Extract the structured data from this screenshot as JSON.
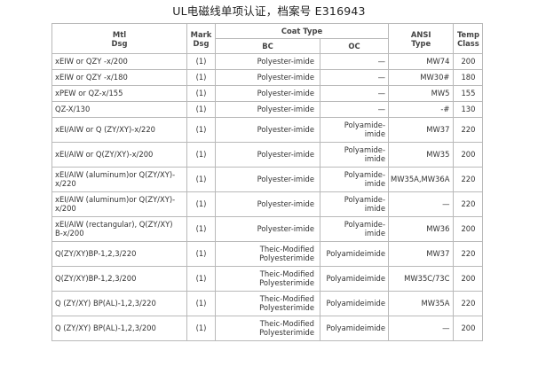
{
  "title": "UL电磁线单项认证，档案号 E316943",
  "table": {
    "headers": {
      "mtl": [
        "Mtl",
        "Dsg"
      ],
      "mark": [
        "Mark",
        "Dsg"
      ],
      "coat_type": "Coat Type",
      "bc": "BC",
      "oc": "OC",
      "ansi": [
        "ANSI",
        "Type"
      ],
      "temp": [
        "Temp",
        "Class"
      ]
    },
    "rows": [
      {
        "mtl": [
          "xEIW or QZY -x/200"
        ],
        "mark": "(1)",
        "bc": [
          "Polyester-imide"
        ],
        "oc": [
          "—"
        ],
        "ansi": "MW74",
        "temp": "200"
      },
      {
        "mtl": [
          "xEIW or QZY -x/180"
        ],
        "mark": "(1)",
        "bc": [
          "Polyester-imide"
        ],
        "oc": [
          "—"
        ],
        "ansi": "MW30#",
        "temp": "180"
      },
      {
        "mtl": [
          "xPEW or QZ-x/155"
        ],
        "mark": "(1)",
        "bc": [
          "Polyester-imide"
        ],
        "oc": [
          "—"
        ],
        "ansi": "MW5",
        "temp": "155"
      },
      {
        "mtl": [
          "QZ-X/130"
        ],
        "mark": "(1)",
        "bc": [
          "Polyester-imide"
        ],
        "oc": [
          "—"
        ],
        "ansi": "-#",
        "temp": "130"
      },
      {
        "mtl": [
          "xEI/AIW or Q (ZY/XY)-x/220"
        ],
        "mark": "(1)",
        "bc": [
          "Polyester-imide"
        ],
        "oc": [
          "Polyamide-",
          "imide"
        ],
        "ansi": "MW37",
        "temp": "220"
      },
      {
        "mtl": [
          "xEI/AIW or Q(ZY/XY)-x/200"
        ],
        "mark": "(1)",
        "bc": [
          "Polyester-imide"
        ],
        "oc": [
          "Polyamide-",
          "imide"
        ],
        "ansi": "MW35",
        "temp": "200"
      },
      {
        "mtl": [
          "xEI/AIW (aluminum)or Q(ZY/XY)-",
          "x/220"
        ],
        "mark": "(1)",
        "bc": [
          "Polyester-imide"
        ],
        "oc": [
          "Polyamide-",
          "imide"
        ],
        "ansi": "MW35A,MW36A",
        "temp": "220"
      },
      {
        "mtl": [
          "xEI/AIW (aluminum)or Q(ZY/XY)-",
          "x/200"
        ],
        "mark": "(1)",
        "bc": [
          "Polyester-imide"
        ],
        "oc": [
          "Polyamide-",
          "imide"
        ],
        "ansi": "—",
        "temp": "220"
      },
      {
        "mtl": [
          "xEI/AIW (rectangular), Q(ZY/XY)",
          "B-x/200"
        ],
        "mark": "(1)",
        "bc": [
          "Polyester-imide"
        ],
        "oc": [
          "Polyamide-",
          "imide"
        ],
        "ansi": "MW36",
        "temp": "200"
      },
      {
        "mtl": [
          "Q(ZY/XY)BP-1,2,3/220"
        ],
        "mark": "(1)",
        "bc": [
          "Theic-Modified",
          "Polyesterimide"
        ],
        "oc": [
          "Polyamideimide"
        ],
        "ansi": "MW37",
        "temp": "220"
      },
      {
        "mtl": [
          "Q(ZY/XY)BP-1,2,3/200"
        ],
        "mark": "(1)",
        "bc": [
          "Theic-Modified",
          "Polyesterimide"
        ],
        "oc": [
          "Polyamideimide"
        ],
        "ansi": "MW35C/73C",
        "temp": "200"
      },
      {
        "mtl": [
          "Q (ZY/XY) BP(AL)-1,2,3/220"
        ],
        "mark": "(1)",
        "bc": [
          "Theic-Modified",
          "Polyesterimide"
        ],
        "oc": [
          "Polyamideimide"
        ],
        "ansi": "MW35A",
        "temp": "220"
      },
      {
        "mtl": [
          "Q (ZY/XY) BP(AL)-1,2,3/200"
        ],
        "mark": "(1)",
        "bc": [
          "Theic-Modified",
          "Polyesterimide"
        ],
        "oc": [
          "Polyamideimide"
        ],
        "ansi": "—",
        "temp": "200"
      }
    ]
  }
}
